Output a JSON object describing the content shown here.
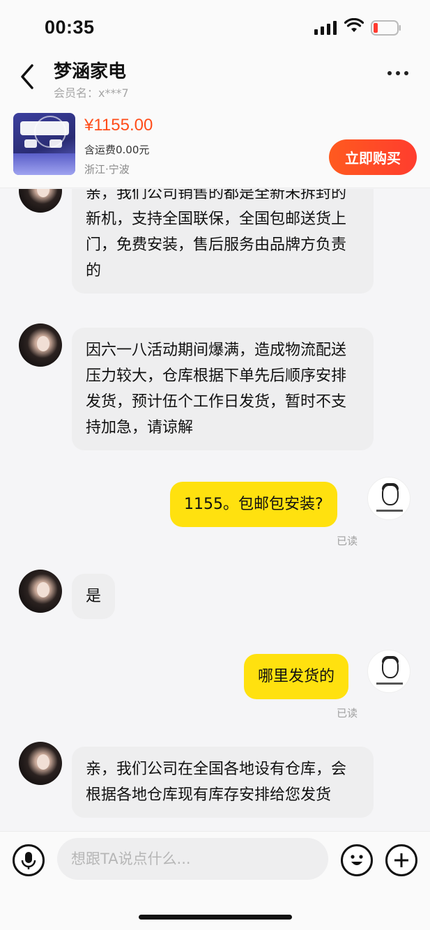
{
  "status_bar": {
    "time": "00:35"
  },
  "header": {
    "shop_name": "梦涵家电",
    "member_label": "会员名：x***7"
  },
  "product": {
    "price": "¥1155.00",
    "shipping": "含运费0.00元",
    "location": "浙江·宁波",
    "buy_label": "立即购买"
  },
  "messages": [
    {
      "side": "left",
      "text": "亲，我们公司销售的都是全新未拆封的新机，支持全国联保，全国包邮送货上门，免费安装，售后服务由品牌方负责的"
    },
    {
      "side": "left",
      "text": "因六一八活动期间爆满，造成物流配送压力较大，仓库根据下单先后顺序安排发货，预计伍个工作日发货，暂时不支持加急，请谅解"
    },
    {
      "side": "right",
      "text": "1155。包邮包安装?",
      "status": "已读"
    },
    {
      "side": "left",
      "text": "是"
    },
    {
      "side": "right",
      "text": "哪里发货的",
      "status": "已读"
    },
    {
      "side": "left",
      "text": "亲，我们公司在全国各地设有仓库，会根据各地仓库现有库存安排给您发货"
    }
  ],
  "input": {
    "placeholder": "想跟TA说点什么..."
  },
  "colors": {
    "accent": "#ff4d1a",
    "my_bubble": "#ffe10f",
    "their_bubble": "#eeeeef"
  },
  "icons": [
    "back-icon",
    "more-icon",
    "mic-icon",
    "emoji-icon",
    "plus-icon",
    "signal-icon",
    "wifi-icon",
    "battery-icon"
  ]
}
